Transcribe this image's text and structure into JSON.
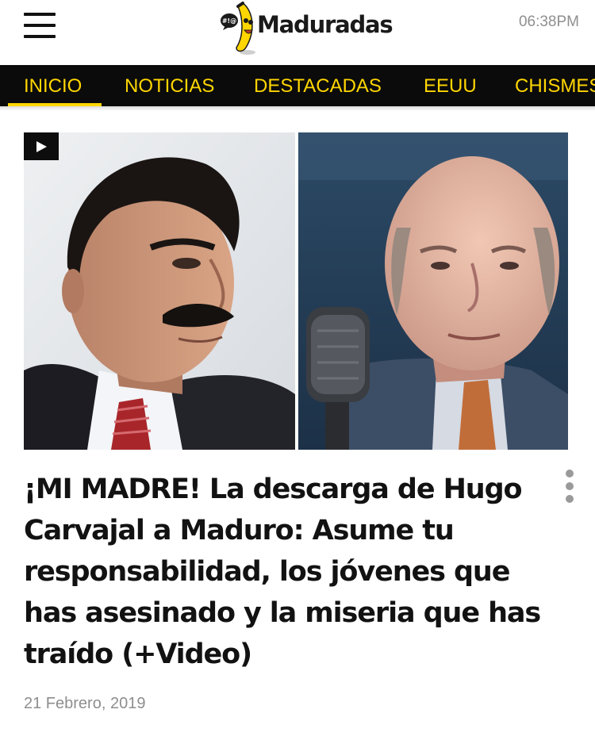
{
  "header": {
    "brand": "Maduradas",
    "logo_bubble": "#!@",
    "time": "06:38PM"
  },
  "nav": {
    "items": [
      {
        "label": "INICIO",
        "active": true
      },
      {
        "label": "NOTICIAS",
        "active": false
      },
      {
        "label": "DESTACADAS",
        "active": false
      },
      {
        "label": "EEUU",
        "active": false
      },
      {
        "label": "CHISMES",
        "active": false
      }
    ]
  },
  "article": {
    "headline": "¡MI MADRE! La descarga de Hugo Carvajal a Maduro: Asume tu responsabilidad, los jóvenes que has asesinado y la miseria que has traído (+Video)",
    "date": "21 Febrero, 2019",
    "media_icon": "play-icon"
  },
  "colors": {
    "accent": "#ffd600",
    "nav_background": "#0b0b0b",
    "text": "#121212",
    "muted": "#8e8e8e"
  }
}
